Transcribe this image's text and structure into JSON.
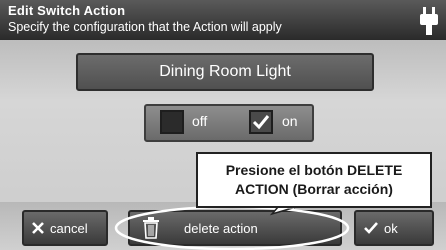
{
  "header": {
    "title": "Edit Switch Action",
    "subtitle": "Specify the configuration that the Action will apply",
    "icon": "plug-icon"
  },
  "device_name": "Dining Room Light",
  "state_options": [
    {
      "label": "off",
      "checked": false
    },
    {
      "label": "on",
      "checked": true
    }
  ],
  "callout": {
    "line1": "Presione el botón DELETE",
    "line2": "ACTION (Borrar acción)"
  },
  "buttons": {
    "cancel": {
      "label": "cancel",
      "icon": "x-icon"
    },
    "delete": {
      "label": "delete action",
      "icon": "trash-icon"
    },
    "ok": {
      "label": "ok",
      "icon": "checkmark-icon"
    }
  },
  "colors": {
    "title_bar": "#2a2a2a",
    "panel": "#cfcfcf",
    "button": "#4a4a4a",
    "callout_bg": "#ffffff"
  }
}
